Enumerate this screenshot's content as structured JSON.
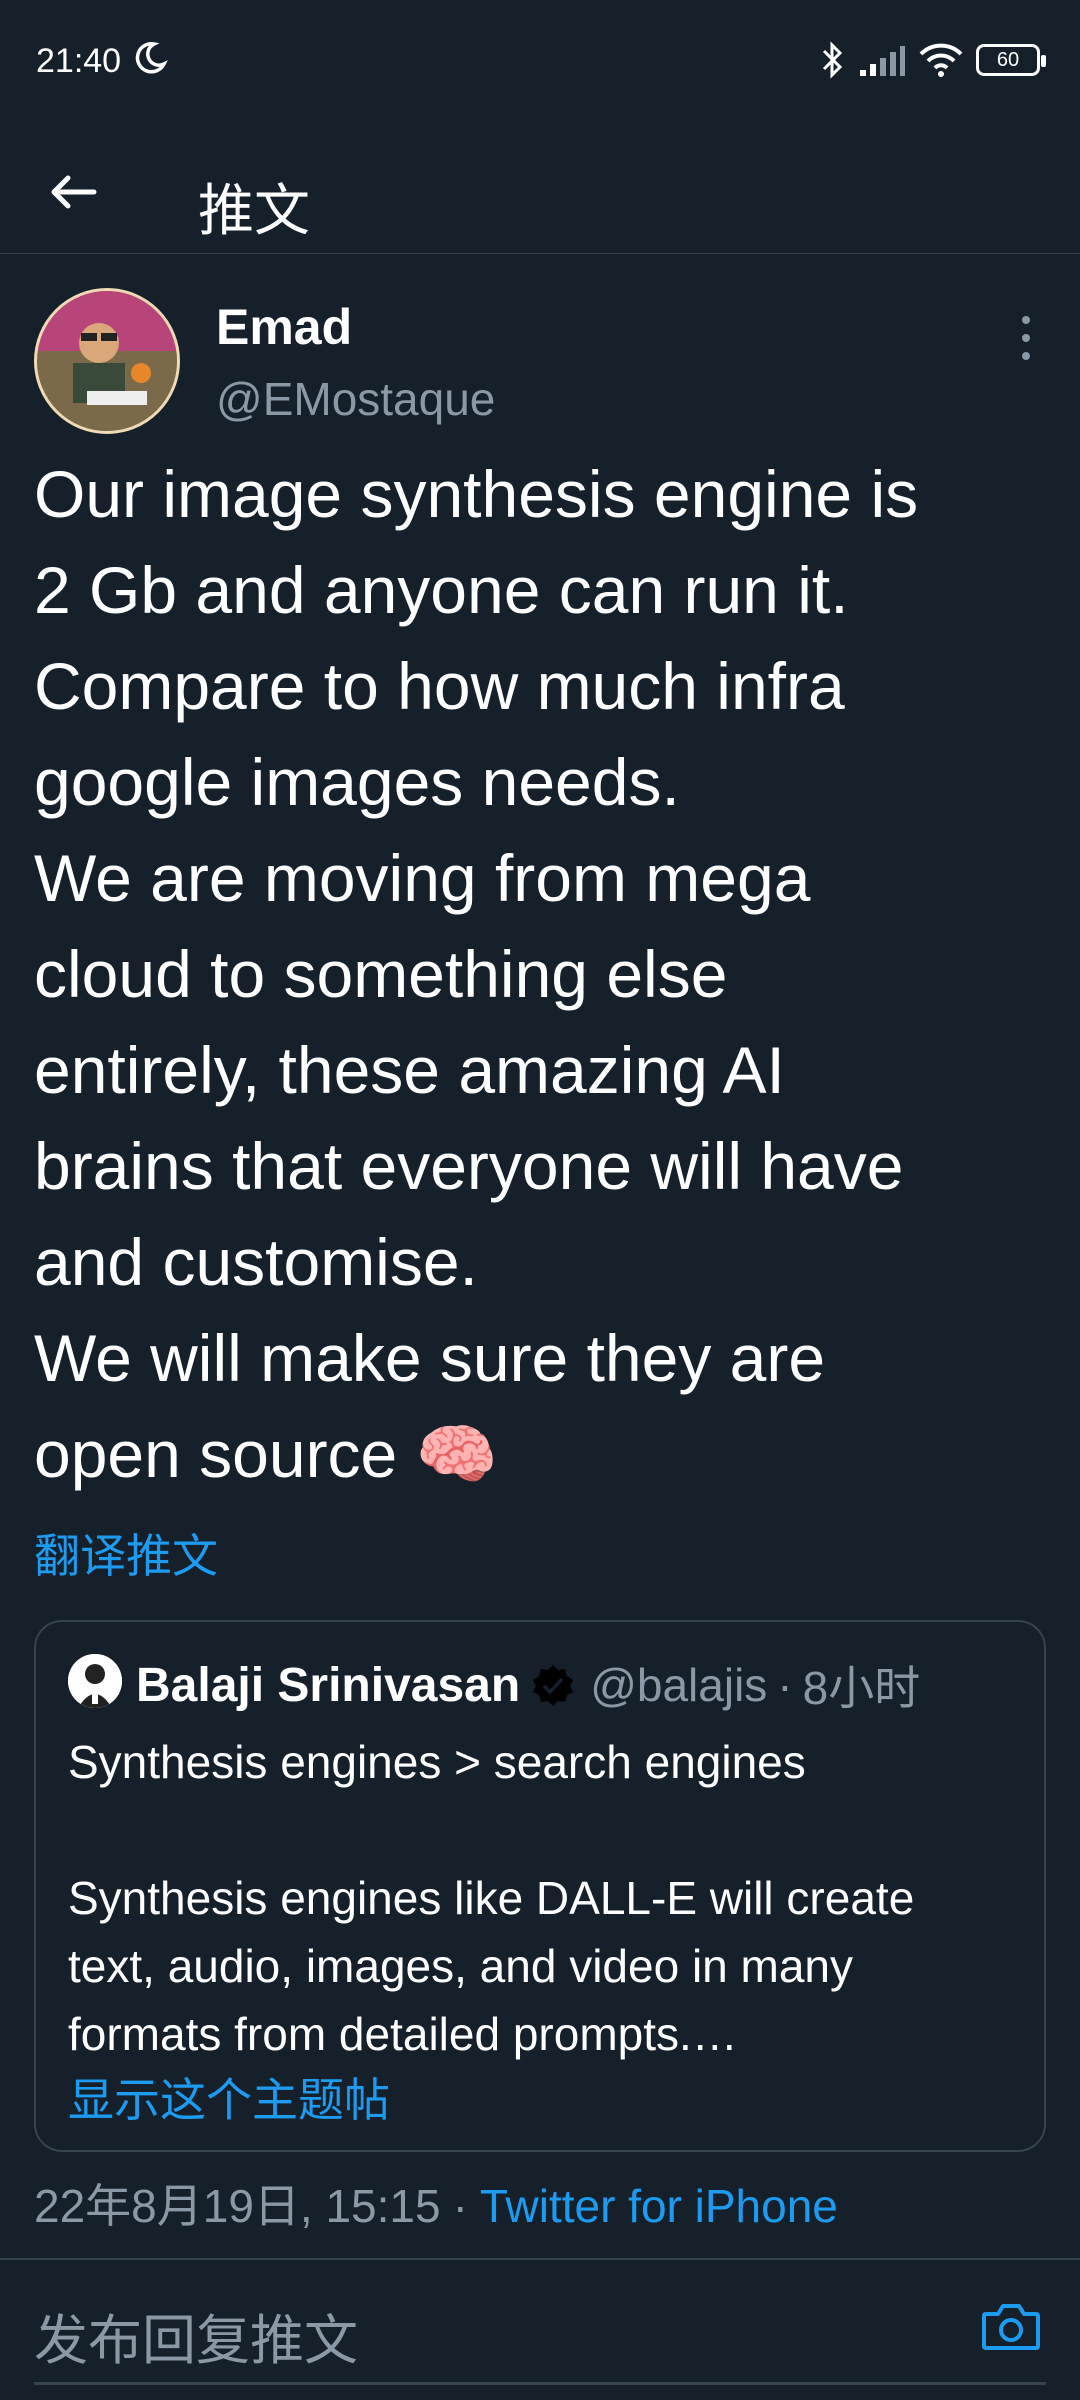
{
  "status_bar": {
    "time": "21:40",
    "battery": "60",
    "icons": [
      "moon-icon",
      "bluetooth-icon",
      "signal-icon",
      "wifi-icon",
      "battery-icon"
    ]
  },
  "header": {
    "back_icon": "arrow-left-icon",
    "title": "推文"
  },
  "tweet": {
    "author_name": "Emad",
    "author_handle": "@EMostaque",
    "text": "Our image synthesis engine is\n2 Gb and anyone can run it.\nCompare to how much infra\ngoogle images needs.\nWe are moving from mega\ncloud to something else\nentirely, these amazing AI\nbrains that everyone will have\nand customise.\nWe will make sure they are\nopen source",
    "emoji": "🧠",
    "translate_label": "翻译推文"
  },
  "quoted_tweet": {
    "author_name": "Balaji Srinivasan",
    "author_handle": "@balajis",
    "time_ago": "8小时",
    "separator": "·",
    "text": "Synthesis engines > search engines\n\nSynthesis engines like DALL-E will create\ntext, audio, images, and video in many\nformats from detailed prompts.…",
    "show_thread_label": "显示这个主题帖"
  },
  "meta": {
    "date": "22年8月19日, 15:15",
    "separator": "·",
    "source": "Twitter for iPhone"
  },
  "reply": {
    "placeholder": "发布回复推文",
    "camera_icon": "camera-icon"
  },
  "colors": {
    "background": "#15202b",
    "accent": "#1d9bf0",
    "secondary_text": "#8b98a5",
    "divider": "#38444d"
  }
}
